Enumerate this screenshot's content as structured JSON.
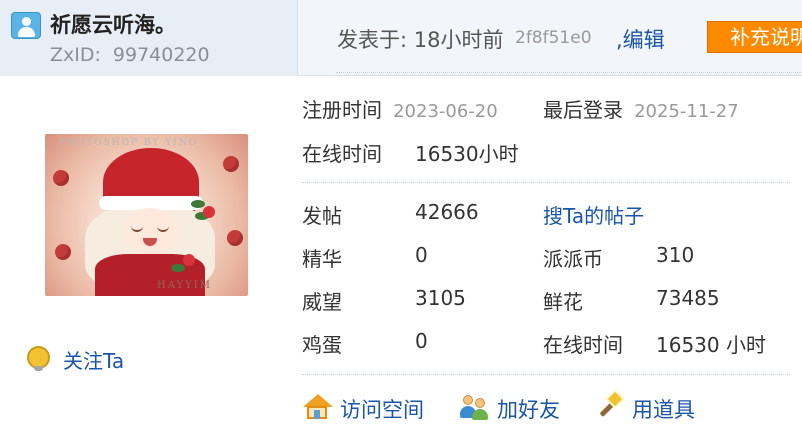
{
  "header": {
    "username": "祈愿云听海。",
    "zxid_label": "ZxID:",
    "zxid_value": "99740220",
    "posted_text": "发表于: 18小时前",
    "post_hash": "2f8f51e0",
    "edit_label": ",编辑",
    "supplement_label": "补充说明"
  },
  "avatar": {
    "caption_top": "PHOTOSHOP BY YINO",
    "caption_bottom": "HAYYIM"
  },
  "follow": {
    "label": "关注Ta"
  },
  "profile": {
    "register_label": "注册时间",
    "register_date": "2023-06-20",
    "lastlogin_label": "最后登录",
    "lastlogin_date": "2025-11-27",
    "online_label": "在线时间",
    "online_value": "16530小时"
  },
  "stats": {
    "posts_label": "发帖",
    "posts_value": "42666",
    "search_posts_link": "搜Ta的帖子",
    "essence_label": "精华",
    "essence_value": "0",
    "coins_label": "派派币",
    "coins_value": "310",
    "prestige_label": "威望",
    "prestige_value": "3105",
    "flowers_label": "鲜花",
    "flowers_value": "73485",
    "eggs_label": "鸡蛋",
    "eggs_value": "0",
    "online_label": "在线时间",
    "online_value": "16530 小时"
  },
  "actions": {
    "visit_space": "访问空间",
    "add_friend": "加好友",
    "use_item": "用道具"
  },
  "colors": {
    "link": "#1a56a8",
    "accent_button": "#ff8a00",
    "header_bg": "#f2f6fb",
    "user_strip_bg": "#e8eef6"
  },
  "icons": {
    "user": "user-icon",
    "follow": "bulb-icon",
    "home": "home-icon",
    "friends": "friends-icon",
    "tool": "magic-wand-icon"
  }
}
